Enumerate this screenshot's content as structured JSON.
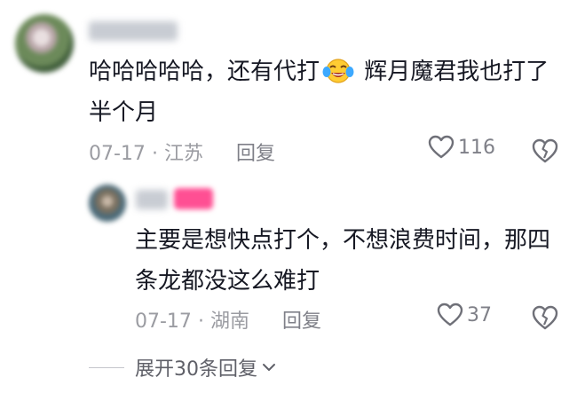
{
  "comment": {
    "text_before_emoji": "哈哈哈哈哈，还有代打",
    "emoji": "crying-laughing-emoji",
    "text_after_emoji": " 辉月魔君我也打了半个月",
    "date": "07-17",
    "separator": "·",
    "location": "江苏",
    "reply_label": "回复",
    "likes": "116"
  },
  "reply": {
    "text": "主要是想快点打个，不想浪费时间，那四条龙都没这么难打",
    "date": "07-17",
    "separator": "·",
    "location": "湖南",
    "reply_label": "回复",
    "likes": "37",
    "badge_color": "#ff4f93"
  },
  "expand": {
    "label": "展开30条回复"
  }
}
